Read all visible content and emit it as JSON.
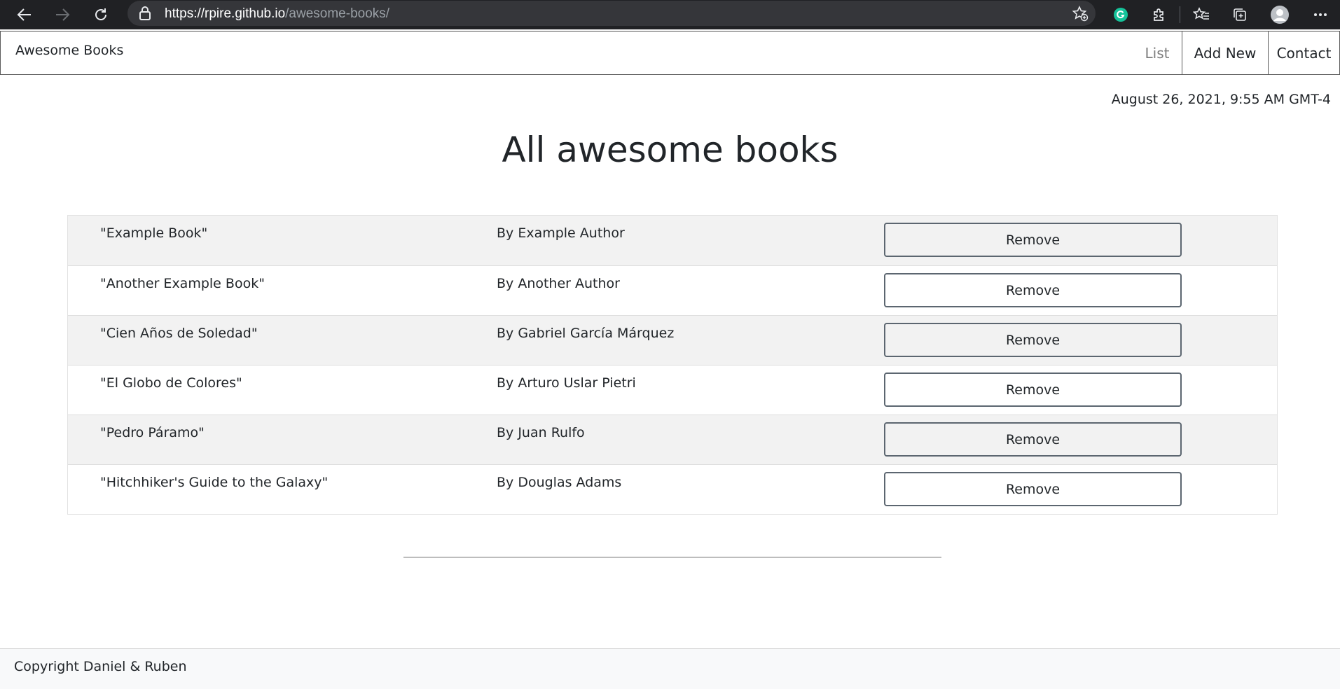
{
  "browser": {
    "url_host": "https://rpire.github.io",
    "url_path": "/awesome-books/"
  },
  "navbar": {
    "brand": "Awesome Books",
    "items": [
      {
        "label": "List"
      },
      {
        "label": "Add New"
      },
      {
        "label": "Contact"
      }
    ]
  },
  "main": {
    "timestamp": "August 26, 2021, 9:55 AM GMT-4",
    "title": "All awesome books",
    "books": [
      {
        "title": "\"Example Book\"",
        "author": "By Example Author",
        "action": "Remove"
      },
      {
        "title": "\"Another Example Book\"",
        "author": "By Another Author",
        "action": "Remove"
      },
      {
        "title": "\"Cien Años de Soledad\"",
        "author": "By Gabriel García Márquez",
        "action": "Remove"
      },
      {
        "title": "\"El Globo de Colores\"",
        "author": "By Arturo Uslar Pietri",
        "action": "Remove"
      },
      {
        "title": "\"Pedro Páramo\"",
        "author": "By Juan Rulfo",
        "action": "Remove"
      },
      {
        "title": "\"Hitchhiker's Guide to the Galaxy\"",
        "author": "By Douglas Adams",
        "action": "Remove"
      }
    ]
  },
  "footer": {
    "text": "Copyright Daniel & Ruben"
  },
  "colors": {
    "striped_row": "#f2f2f2",
    "button_border": "#5c6670",
    "muted_nav": "#7d7d7d",
    "chrome_bg": "#202124",
    "footer_bg": "#f8f9fa"
  },
  "icons": [
    "back-arrow-icon",
    "forward-arrow-icon",
    "reload-icon",
    "lock-icon",
    "add-favorite-icon",
    "grammarly-icon",
    "extensions-icon",
    "favorites-icon",
    "collections-icon",
    "profile-avatar-icon",
    "more-options-icon"
  ]
}
